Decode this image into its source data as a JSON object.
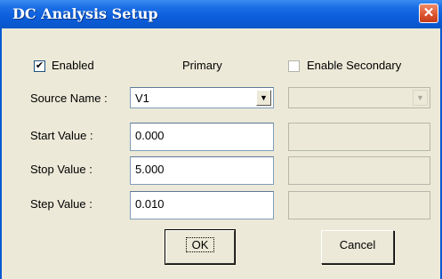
{
  "window": {
    "title": "DC Analysis Setup"
  },
  "enabled": {
    "label": "Enabled",
    "checked": true,
    "check_glyph": "✔"
  },
  "enable_secondary": {
    "label": "Enable Secondary",
    "checked": false
  },
  "primary_header": "Primary",
  "source_name": {
    "label": "Source Name :",
    "value": "V1"
  },
  "start_value": {
    "label": "Start Value :",
    "value": "0.000"
  },
  "stop_value": {
    "label": "Stop Value :",
    "value": "5.000"
  },
  "step_value": {
    "label": "Step Value :",
    "value": "0.010"
  },
  "buttons": {
    "ok": "OK",
    "cancel": "Cancel"
  },
  "icons": {
    "close": "close-icon",
    "dropdown": "dropdown-arrow-icon"
  },
  "colors": {
    "titlebar": "#0a5ddb",
    "close": "#d9522d",
    "face": "#ece9d8"
  }
}
